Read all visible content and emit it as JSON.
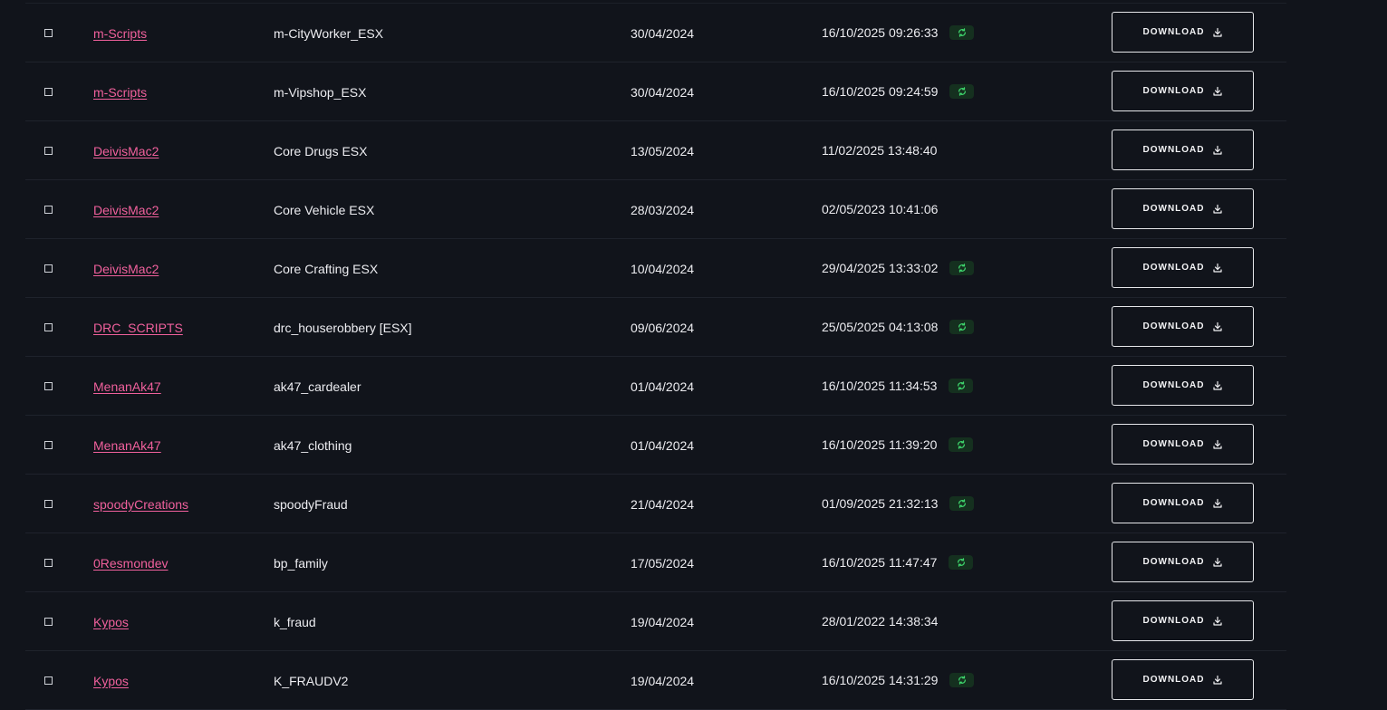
{
  "table": {
    "download_label": "DOWNLOAD",
    "accent_color": "#f0609c",
    "sync_color": "#3ed56c",
    "rows": [
      {
        "author": "m-Scripts",
        "resource": "m-CityWorker_ESX",
        "created": "30/04/2024",
        "updated": "16/10/2025 09:26:33",
        "synced": true
      },
      {
        "author": "m-Scripts",
        "resource": "m-Vipshop_ESX",
        "created": "30/04/2024",
        "updated": "16/10/2025 09:24:59",
        "synced": true
      },
      {
        "author": "DeivisMac2",
        "resource": "Core Drugs ESX",
        "created": "13/05/2024",
        "updated": "11/02/2025 13:48:40",
        "synced": false
      },
      {
        "author": "DeivisMac2",
        "resource": "Core Vehicle ESX",
        "created": "28/03/2024",
        "updated": "02/05/2023 10:41:06",
        "synced": false
      },
      {
        "author": "DeivisMac2",
        "resource": "Core Crafting ESX",
        "created": "10/04/2024",
        "updated": "29/04/2025 13:33:02",
        "synced": true
      },
      {
        "author": "DRC_SCRIPTS",
        "resource": "drc_houserobbery [ESX]",
        "created": "09/06/2024",
        "updated": "25/05/2025 04:13:08",
        "synced": true
      },
      {
        "author": "MenanAk47",
        "resource": "ak47_cardealer",
        "created": "01/04/2024",
        "updated": "16/10/2025 11:34:53",
        "synced": true
      },
      {
        "author": "MenanAk47",
        "resource": "ak47_clothing",
        "created": "01/04/2024",
        "updated": "16/10/2025 11:39:20",
        "synced": true
      },
      {
        "author": "spoodyCreations",
        "resource": "spoodyFraud",
        "created": "21/04/2024",
        "updated": "01/09/2025 21:32:13",
        "synced": true
      },
      {
        "author": "0Resmondev",
        "resource": "bp_family",
        "created": "17/05/2024",
        "updated": "16/10/2025 11:47:47",
        "synced": true
      },
      {
        "author": "Kypos",
        "resource": "k_fraud",
        "created": "19/04/2024",
        "updated": "28/01/2022 14:38:34",
        "synced": false
      },
      {
        "author": "Kypos",
        "resource": "K_FRAUDV2",
        "created": "19/04/2024",
        "updated": "16/10/2025 14:31:29",
        "synced": true
      }
    ]
  }
}
